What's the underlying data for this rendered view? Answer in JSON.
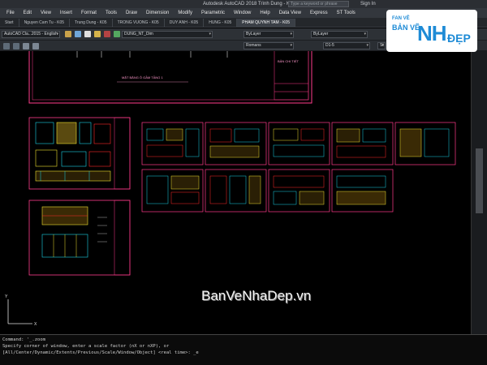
{
  "window": {
    "title": "Autodesk AutoCAD 2018   Trình Dung - K07.dwg",
    "search_placeholder": "Type a keyword or phrase",
    "user": "Sign In"
  },
  "menu": [
    "File",
    "Edit",
    "View",
    "Insert",
    "Format",
    "Tools",
    "Draw",
    "Dimension",
    "Modify",
    "Parametric",
    "Window",
    "Help",
    "Data View",
    "Express",
    "ST Tools"
  ],
  "tabs": [
    {
      "label": "Start",
      "active": false
    },
    {
      "label": "Nguyen Cam Tu - K05",
      "active": false
    },
    {
      "label": "Trung Dung - K05",
      "active": false
    },
    {
      "label": "TRONG VUONG - K05",
      "active": false
    },
    {
      "label": "DUY ANH - K05",
      "active": false
    },
    {
      "label": "HUNG - K05",
      "active": false
    },
    {
      "label": "PHAM QUYNH TAM - K05",
      "active": true
    }
  ],
  "toolbar": {
    "workspace": "AutoCAD Cla...2015 - English",
    "dimstyle": "DUNG_NT_Dim",
    "layer": "ByLayer",
    "linetype": "ByLayer",
    "textstyle": "Romans",
    "scale": "D1-5",
    "style2": "St"
  },
  "drawing": {
    "plan_caption": "MẶT BẰNG Ô GẦM TẦNG 1",
    "sheet_label": "BẢN CHI TIẾT"
  },
  "command_line": [
    "Command: '_.zoom",
    "Specify corner of window, enter a scale factor (nX or nXP), or",
    "[All/Center/Dynamic/Extents/Previous/Scale/Window/Object] <real time>: _e"
  ],
  "watermark": {
    "logo_line1": "FAN VÊ",
    "logo_line2": "BẢN VẼ",
    "logo_line3": "NH",
    "logo_line4": "ĐẸP",
    "site": "BanVeNhaDep.vn"
  },
  "colors": {
    "sheet_border": "#ff3b8b",
    "detail_cyan": "#19d3e6",
    "detail_yellow": "#f0e130",
    "detail_red": "#ff2a2a",
    "brand": "#1e8bd6"
  }
}
